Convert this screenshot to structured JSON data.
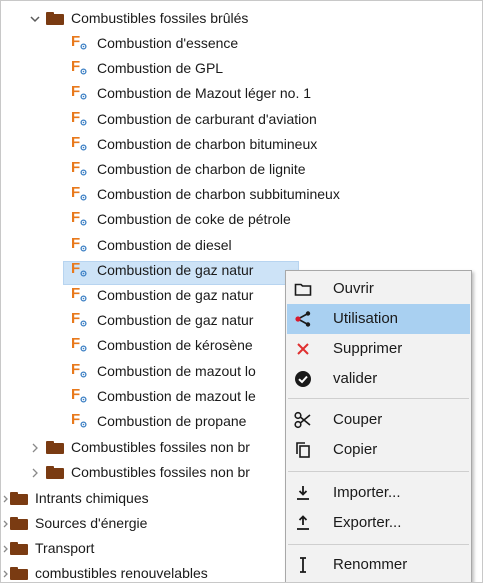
{
  "tree": {
    "expanded_category": "Combustibles fossiles brûlés",
    "processes": [
      "Combustion d'essence",
      "Combustion de GPL",
      "Combustion de Mazout léger no. 1",
      "Combustion de carburant d'aviation",
      "Combustion de charbon bitumineux",
      "Combustion de charbon de lignite",
      "Combustion de charbon subbitumineux",
      "Combustion de coke de pétrole",
      "Combustion de diesel",
      "Combustion de gaz natur",
      "Combustion de gaz natur",
      "Combustion de gaz natur",
      "Combustion de kérosène",
      "Combustion de mazout lo",
      "Combustion de mazout le",
      "Combustion de propane"
    ],
    "sibling_categories": [
      "Combustibles fossiles non br",
      "Combustibles fossiles non br"
    ],
    "top_categories": [
      "Intrants chimiques",
      "Sources d'énergie",
      "Transport",
      "combustibles renouvelables"
    ]
  },
  "context_menu": {
    "items": [
      {
        "label": "Ouvrir",
        "icon": "folder-outline-icon"
      },
      {
        "label": "Utilisation",
        "icon": "share-icon"
      },
      {
        "label": "Supprimer",
        "icon": "delete-x-icon"
      },
      {
        "label": "valider",
        "icon": "check-circle-icon"
      },
      {
        "label": "Couper",
        "icon": "scissors-icon"
      },
      {
        "label": "Copier",
        "icon": "copy-icon"
      },
      {
        "label": "Importer...",
        "icon": "import-icon"
      },
      {
        "label": "Exporter...",
        "icon": "export-icon"
      },
      {
        "label": "Renommer",
        "icon": "rename-cursor-icon"
      }
    ]
  },
  "colors": {
    "folder": "#7a3b12",
    "process_icon": "#e8791c",
    "selection": "#cde3f7",
    "menu_highlight": "#a9d0f1",
    "delete_red": "#e03030"
  }
}
